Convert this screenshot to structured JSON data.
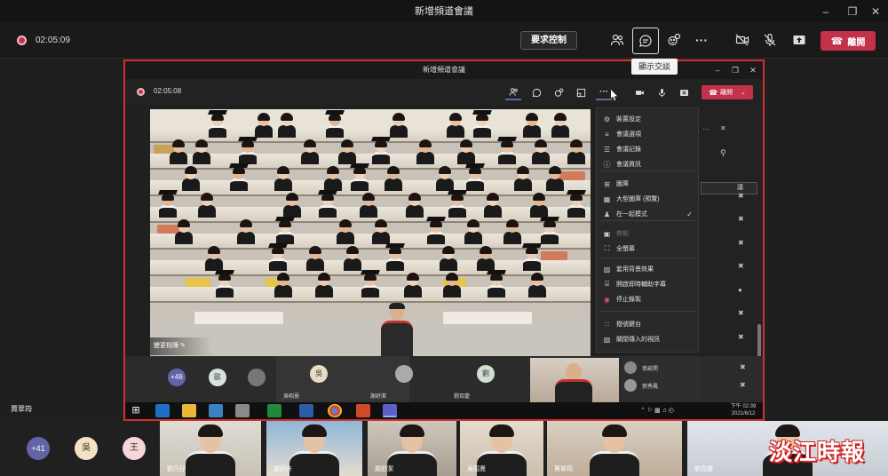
{
  "outer": {
    "title": "新增頻道會議",
    "timer": "02:05:09",
    "request_control": "要求控制",
    "leave": "離開",
    "tooltip": "顯示交談",
    "presenter_name": "賈翠筠"
  },
  "inner": {
    "title": "新增頻道會議",
    "timer": "02:05:08",
    "leave": "離開",
    "scene_label": "變更相簿",
    "panel_search_tail": "議"
  },
  "more_menu": {
    "items": [
      {
        "icon": "gear-icon",
        "label": "裝置設定"
      },
      {
        "icon": "sliders-icon",
        "label": "會議選項"
      },
      {
        "icon": "notes-icon",
        "label": "會議記錄"
      },
      {
        "icon": "info-icon",
        "label": "會議資訊"
      },
      {
        "icon": "grid-icon",
        "label": "圖庫"
      },
      {
        "icon": "large-grid-icon",
        "label": "大型圖庫 (預覽)"
      },
      {
        "icon": "together-icon",
        "label": "在一起模式"
      },
      {
        "icon": "focus-icon",
        "label": "焦點"
      },
      {
        "icon": "fullscreen-icon",
        "label": "全螢幕"
      },
      {
        "icon": "background-icon",
        "label": "套用背景效果"
      },
      {
        "icon": "captions-icon",
        "label": "開啟即時輔助字幕"
      },
      {
        "icon": "record-icon",
        "label": "停止錄製"
      },
      {
        "icon": "keypad-icon",
        "label": "撥號鍵台"
      },
      {
        "icon": "video-off-icon",
        "label": "關閉傳入的視訊"
      }
    ]
  },
  "participants": [
    {
      "name": "翁崧閔"
    },
    {
      "name": "張秀鳳"
    }
  ],
  "inner_gallery": {
    "overflow_count": "+46",
    "avatars": [
      {
        "initial": "歐"
      },
      {
        "initial": "吳",
        "name": "吳昭熹"
      },
      {
        "name": "謝舒潔"
      },
      {
        "initial": "劉",
        "name": "劉百慶"
      }
    ]
  },
  "taskbar": {
    "time": "下午 02:39",
    "date": "2021/6/12"
  },
  "bottom_gallery": {
    "overflow_count": "+41",
    "avatars": [
      {
        "initial": "吳"
      },
      {
        "initial": "王"
      }
    ],
    "tiles": [
      {
        "name": "劉乃仔"
      },
      {
        "name": "謝舒卉"
      },
      {
        "name": "謝舒潔"
      },
      {
        "name": "吳昭熹"
      },
      {
        "name": "賈翠筠"
      },
      {
        "name": "劉百慶"
      }
    ]
  },
  "watermark": "淡江時報",
  "colors": {
    "leave_red": "#c4314b",
    "accent": "#6264a7",
    "highlight_border": "#d03030"
  }
}
